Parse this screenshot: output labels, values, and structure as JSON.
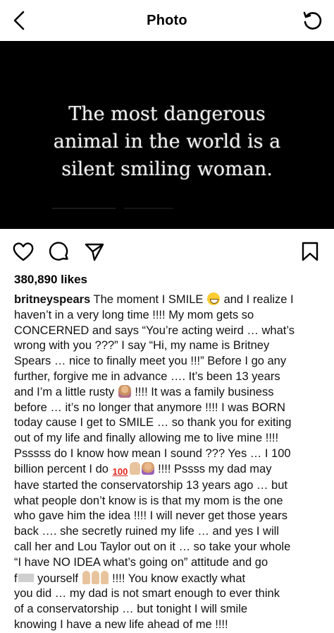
{
  "header": {
    "title": "Photo"
  },
  "post_image": {
    "quote_lines": [
      "The most dangerous",
      "animal in the world is a",
      "silent smiling woman."
    ]
  },
  "actions": {
    "icons": [
      "heart-icon",
      "comment-icon",
      "share-icon",
      "bookmark-icon"
    ]
  },
  "likes": "380,890 likes",
  "caption": {
    "username": "britneyspears",
    "lines": [
      [
        " The moment I SMILE ",
        {
          "emoji": "grinning-face"
        },
        " and I realize I"
      ],
      [
        "haven’t in a very long time !!!! My mom gets so"
      ],
      [
        "CONCERNED and says “You’re acting weird … what’s"
      ],
      [
        "wrong with you ???”  I say “Hi, my name is Britney"
      ],
      [
        "Spears … nice to finally meet you !!!” Before I go any"
      ],
      [
        "further, forgive me in advance …. It’s been 13 years"
      ],
      [
        "and I’m a little rusty ",
        {
          "emoji": "person-tipping-hand"
        },
        " !!!! It was a family business"
      ],
      [
        "before … it’s no longer that anymore !!!! I was BORN"
      ],
      [
        "today cause I get to SMILE … so thank you for exiting"
      ],
      [
        "out of my life and finally allowing me to live mine !!!!"
      ],
      [
        "Psssss do I know how mean I sound ???  Yes … I 100"
      ],
      [
        "billion percent I do ",
        {
          "emoji": "hundred-points"
        },
        {
          "emoji": "thumbs-up"
        },
        {
          "emoji": "person-shrugging"
        },
        " !!!! Pssss my dad may"
      ],
      [
        "have started the conservatorship 13 years ago … but"
      ],
      [
        "what people don’t know is is that my mom is the one"
      ],
      [
        "who gave him the idea !!!! I will never get those years"
      ],
      [
        "back …. she secretly ruined my life … and yes I will"
      ],
      [
        "call her and Lou Taylor out on it … so take your whole"
      ],
      [
        "“I have NO IDEA what’s going on” attitude and go"
      ],
      [
        "f",
        {
          "emoji": "censored"
        },
        " yourself ",
        {
          "emoji": "middle-finger"
        },
        {
          "emoji": "middle-finger"
        },
        {
          "emoji": "middle-finger"
        },
        " !!!! You know exactly what"
      ],
      [
        "you did … my dad is not smart enough to ever think"
      ],
      [
        "of a conservatorship … but tonight I will smile"
      ],
      [
        "knowing I have a new life ahead of me !!!!"
      ]
    ]
  }
}
